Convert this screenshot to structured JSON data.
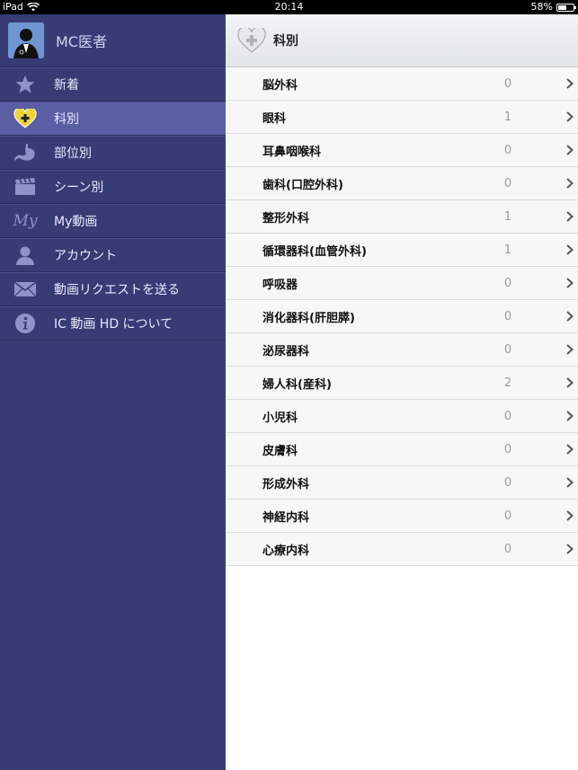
{
  "status": {
    "device": "iPad",
    "time": "20:14",
    "battery": "58%",
    "battery_level": 0.58
  },
  "sidebar": {
    "profile_name": "MC医者",
    "items": [
      {
        "label": "新着",
        "icon": "star-icon"
      },
      {
        "label": "科別",
        "icon": "heart-plus-icon",
        "active": true
      },
      {
        "label": "部位別",
        "icon": "stomach-icon"
      },
      {
        "label": "シーン別",
        "icon": "clapperboard-icon"
      },
      {
        "label": "My動画",
        "icon": "my-text-icon",
        "icon_text": "My"
      },
      {
        "label": "アカウント",
        "icon": "person-icon"
      },
      {
        "label": "動画リクエストを送る",
        "icon": "envelope-icon"
      },
      {
        "label": "IC 動画 HD について",
        "icon": "info-icon"
      }
    ]
  },
  "main": {
    "title": "科別",
    "rows": [
      {
        "label": "脳外科",
        "count": "0"
      },
      {
        "label": "眼科",
        "count": "1"
      },
      {
        "label": "耳鼻咽喉科",
        "count": "0"
      },
      {
        "label": "歯科(口腔外科)",
        "count": "0"
      },
      {
        "label": "整形外科",
        "count": "1"
      },
      {
        "label": "循環器科(血管外科)",
        "count": "1"
      },
      {
        "label": "呼吸器",
        "count": "0"
      },
      {
        "label": "消化器科(肝胆膵)",
        "count": "0"
      },
      {
        "label": "泌尿器科",
        "count": "0"
      },
      {
        "label": "婦人科(産科)",
        "count": "2"
      },
      {
        "label": "小児科",
        "count": "0"
      },
      {
        "label": "皮膚科",
        "count": "0"
      },
      {
        "label": "形成外科",
        "count": "0"
      },
      {
        "label": "神経内科",
        "count": "0"
      },
      {
        "label": "心療内科",
        "count": "0"
      }
    ]
  },
  "colors": {
    "sidebar_bg": "#383c74",
    "sidebar_active": "#5a5ea3",
    "icon_light": "#8e93c8"
  }
}
